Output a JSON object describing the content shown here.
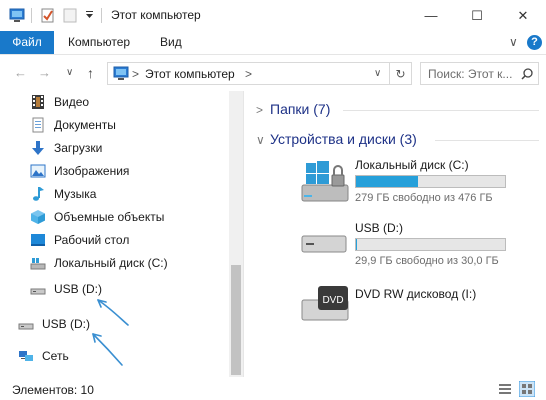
{
  "window": {
    "title": "Этот компьютер",
    "minimize": "—",
    "maximize": "☐",
    "close": "✕"
  },
  "ribbon": {
    "tabs": [
      "Файл",
      "Компьютер",
      "Вид"
    ],
    "help": "?",
    "expand": "∨"
  },
  "nav": {
    "back": "←",
    "forward": "→",
    "recent": "∨",
    "up": "↑",
    "address_path": "Этот компьютер",
    "address_sep": ">",
    "refresh": "↻",
    "search_placeholder": "Поиск: Этот к..."
  },
  "sidebar": {
    "items": [
      {
        "label": "Видео",
        "icon": "video-icon"
      },
      {
        "label": "Документы",
        "icon": "documents-icon"
      },
      {
        "label": "Загрузки",
        "icon": "downloads-icon"
      },
      {
        "label": "Изображения",
        "icon": "pictures-icon"
      },
      {
        "label": "Музыка",
        "icon": "music-icon"
      },
      {
        "label": "Объемные объекты",
        "icon": "3d-objects-icon"
      },
      {
        "label": "Рабочий стол",
        "icon": "desktop-icon"
      },
      {
        "label": "Локальный диск (C:)",
        "icon": "local-disk-icon"
      },
      {
        "label": "USB (D:)",
        "icon": "usb-drive-icon"
      },
      {
        "label": "USB (D:)",
        "icon": "usb-drive-icon"
      },
      {
        "label": "Сеть",
        "icon": "network-icon"
      }
    ]
  },
  "content": {
    "folders_group": "Папки (7)",
    "devices_group": "Устройства и диски (3)",
    "drives": [
      {
        "name": "Локальный диск (C:)",
        "free": "279 ГБ свободно из 476 ГБ",
        "used_fraction": 0.414,
        "icon": "windows-disk-icon"
      },
      {
        "name": "USB (D:)",
        "free": "29,9 ГБ свободно из 30,0 ГБ",
        "used_fraction": 0.003,
        "icon": "usb-drive-icon"
      },
      {
        "name": "DVD RW дисковод (I:)",
        "icon": "dvd-drive-icon",
        "dvd_label": "DVD"
      }
    ]
  },
  "status": {
    "text": "Элементов: 10"
  },
  "colors": {
    "accent": "#1979ca",
    "drive_fill": "#26a0da",
    "group_header": "#1e3287",
    "annotation_arrow": "#3a8fd1"
  }
}
